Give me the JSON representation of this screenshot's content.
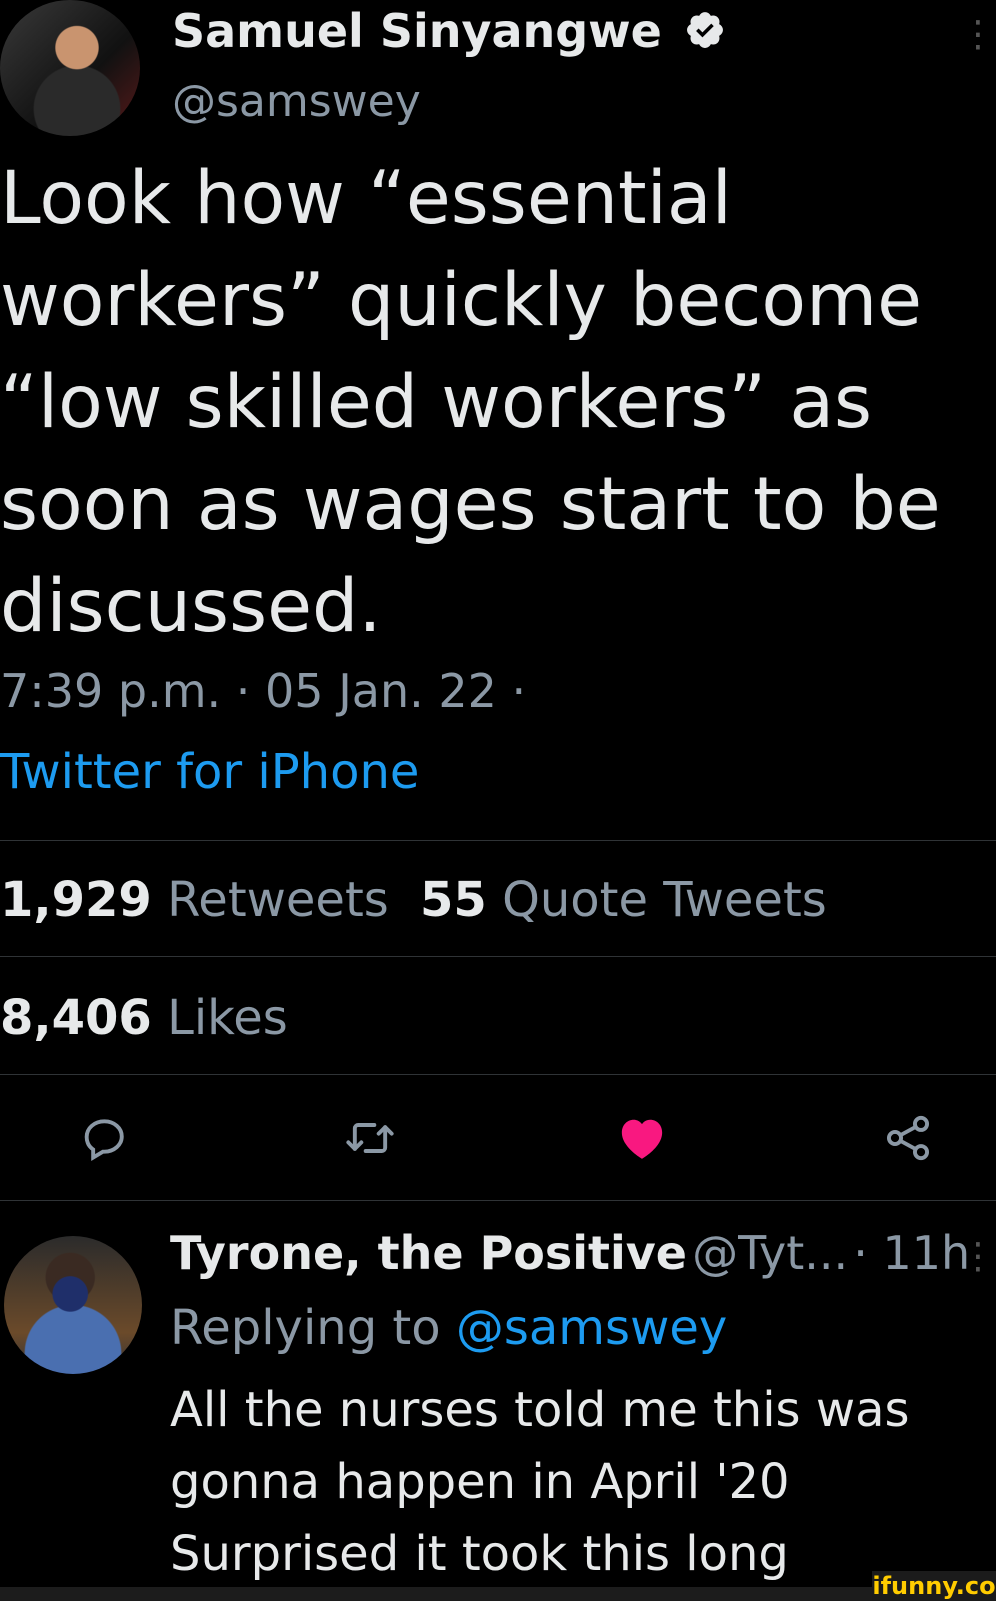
{
  "tweet": {
    "author_name": "Samuel Sinyangwe",
    "author_handle": "@samswey",
    "text": "Look how “essential\nworkers” quickly become\n“low skilled workers” as\nsoon as wages start to be\ndiscussed.",
    "timestamp": "7:39 p.m. · 05 Jan. 22 ·",
    "source": "Twitter for iPhone",
    "retweets_count": "1,929",
    "retweets_label": "Retweets",
    "quotes_count": "55",
    "quotes_label": "Quote Tweets",
    "likes_count": "8,406",
    "likes_label": "Likes"
  },
  "actions": {
    "icons": [
      "reply-icon",
      "retweet-icon",
      "like-icon",
      "share-icon"
    ],
    "like_color": "#f91880"
  },
  "reply": {
    "author_name": "Tyrone, the Positive",
    "author_handle": "@Tyt...",
    "time": "· 11h",
    "replying_prefix": "Replying to",
    "replying_handle": "@samswey",
    "text": "All the nurses told me this was\ngonna happen in April '20\nSurprised it took this long"
  },
  "watermark": "ifunny.co",
  "colors": {
    "background": "#000000",
    "accent": "#1d9bf0",
    "secondary_text": "#8b98a5",
    "verified": "#e7e9ea"
  }
}
